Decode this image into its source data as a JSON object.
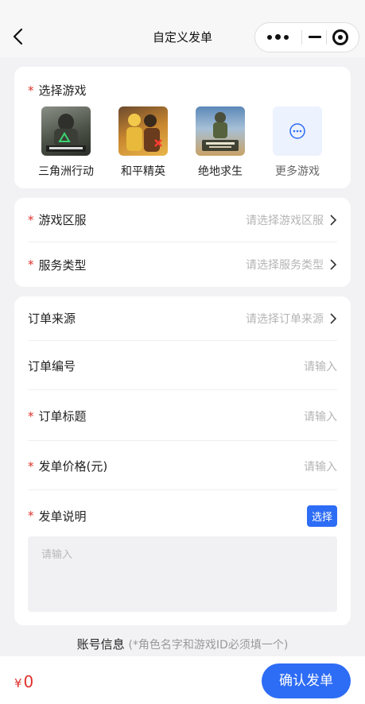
{
  "nav": {
    "title": "自定义发单"
  },
  "games": {
    "label": "选择游戏",
    "items": [
      {
        "name": "三角洲行动",
        "icon": "delta-force-icon"
      },
      {
        "name": "和平精英",
        "icon": "peace-elite-icon"
      },
      {
        "name": "绝地求生",
        "icon": "pubg-icon"
      },
      {
        "name": "更多游戏",
        "icon": "more-games-icon"
      }
    ]
  },
  "server": {
    "label": "游戏区服",
    "placeholder": "请选择游戏区服"
  },
  "service": {
    "label": "服务类型",
    "placeholder": "请选择服务类型"
  },
  "source": {
    "label": "订单来源",
    "placeholder": "请选择订单来源"
  },
  "order_no": {
    "label": "订单编号",
    "placeholder": "请输入"
  },
  "order_title": {
    "label": "订单标题",
    "placeholder": "请输入"
  },
  "price_field": {
    "label": "发单价格(元)",
    "placeholder": "请输入"
  },
  "desc": {
    "label": "发单说明",
    "choose_label": "选择",
    "placeholder": "请输入"
  },
  "account": {
    "title": "账号信息",
    "hint": "(*角色名字和游戏ID必须填一个)"
  },
  "footer": {
    "currency": "¥",
    "total": "0",
    "confirm_label": "确认发单"
  },
  "colors": {
    "accent": "#2d6cf5",
    "required": "#e0312b"
  }
}
